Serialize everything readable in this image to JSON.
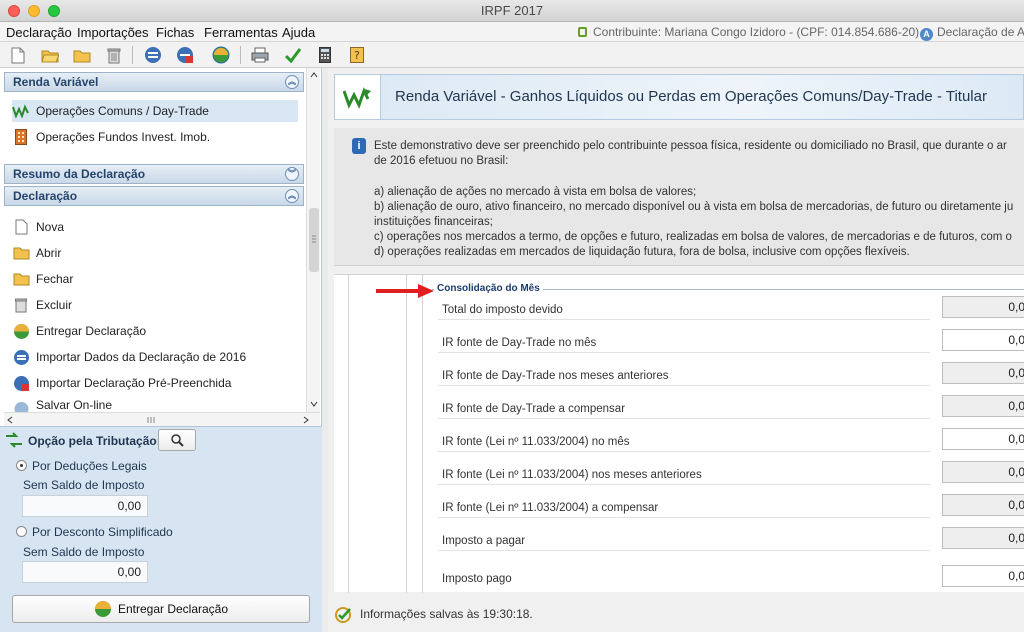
{
  "window": {
    "title": "IRPF 2017"
  },
  "menu": [
    "Declaração",
    "Importações",
    "Fichas",
    "Ferramentas",
    "Ajuda"
  ],
  "header": {
    "contributor": "Contribuinte: Mariana Congo Izidoro - (CPF: 014.854.686-20)",
    "declaration": "Declaração de Aj"
  },
  "sidebar": {
    "renda_title": "Renda Variável",
    "renda_items": [
      "Operações Comuns / Day-Trade",
      "Operações Fundos Invest. Imob."
    ],
    "resumo_title": "Resumo da Declaração",
    "decl_title": "Declaração",
    "decl_items": [
      "Nova",
      "Abrir",
      "Fechar",
      "Excluir",
      "Entregar Declaração",
      "Importar Dados da Declaração de 2016",
      "Importar Declaração Pré-Preenchida",
      "Salvar On-line"
    ]
  },
  "tributacao": {
    "title": "Opção pela Tributação:",
    "opt1": "Por Deduções Legais",
    "opt1_sub": "Sem Saldo de Imposto",
    "opt1_value": "0,00",
    "opt2": "Por Desconto Simplificado",
    "opt2_sub": "Sem Saldo de Imposto",
    "opt2_value": "0,00",
    "submit": "Entregar Declaração",
    "selected": "opt1"
  },
  "page": {
    "title": "Renda Variável - Ganhos Líquidos ou Perdas em Operações Comuns/Day-Trade - Titular",
    "info_lines": [
      "Este demonstrativo deve ser preenchido pelo contribuinte pessoa física, residente ou domiciliado no Brasil, que durante o ar",
      "de 2016 efetuou no Brasil:",
      "a) alienação de ações no mercado à vista em bolsa de valores;",
      "b) alienação de ouro, ativo financeiro, no mercado disponível ou à vista em bolsa de mercadorias, de futuro ou diretamente ju",
      "instituições financeiras;",
      "c) operações nos mercados a termo, de opções e futuro, realizadas em bolsa de valores, de mercadorias e de futuros, com o",
      "d) operações realizadas em mercados de liquidação futura, fora de bolsa, inclusive com opções flexíveis."
    ],
    "section_title": "Consolidação do Mês",
    "rows": [
      {
        "label": "Total do imposto devido",
        "value": "0,0"
      },
      {
        "label": "IR fonte de Day-Trade no mês",
        "value": "0,0"
      },
      {
        "label": "IR fonte de Day-Trade nos meses anteriores",
        "value": "0,0"
      },
      {
        "label": "IR fonte de Day-Trade a compensar",
        "value": "0,0"
      },
      {
        "label": "IR fonte (Lei nº 11.033/2004) no mês",
        "value": "0,0"
      },
      {
        "label": "IR fonte (Lei nº 11.033/2004) nos meses anteriores",
        "value": "0,0"
      },
      {
        "label": "IR fonte (Lei nº 11.033/2004) a compensar",
        "value": "0,0"
      },
      {
        "label": "Imposto a pagar",
        "value": "0,0"
      },
      {
        "label": "Imposto pago",
        "value": "0,0"
      }
    ],
    "status": "Informações salvas às 19:30:18."
  }
}
